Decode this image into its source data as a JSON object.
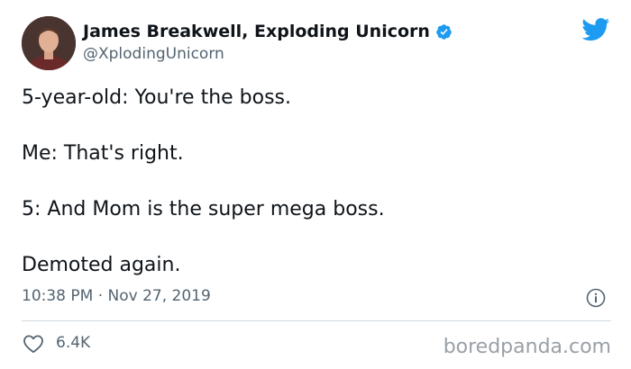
{
  "tweet": {
    "author": {
      "display_name": "James Breakwell, Exploding Unicorn",
      "handle": "@XplodingUnicorn",
      "verified": true,
      "avatar_icon": "profile-photo"
    },
    "brand_icon": "twitter-bird-icon",
    "body_lines": [
      "5-year-old: You're the boss.",
      "Me: That's right.",
      "5: And Mom is the super mega boss.",
      "Demoted again."
    ],
    "timestamp": "10:38 PM · Nov 27, 2019",
    "likes": "6.4K"
  },
  "watermark": "boredpanda.com",
  "colors": {
    "text": "#0f1419",
    "secondary": "#536471",
    "brand_blue": "#1d9bf0",
    "divider": "#cfd9de",
    "watermark": "#9aa0a6"
  }
}
